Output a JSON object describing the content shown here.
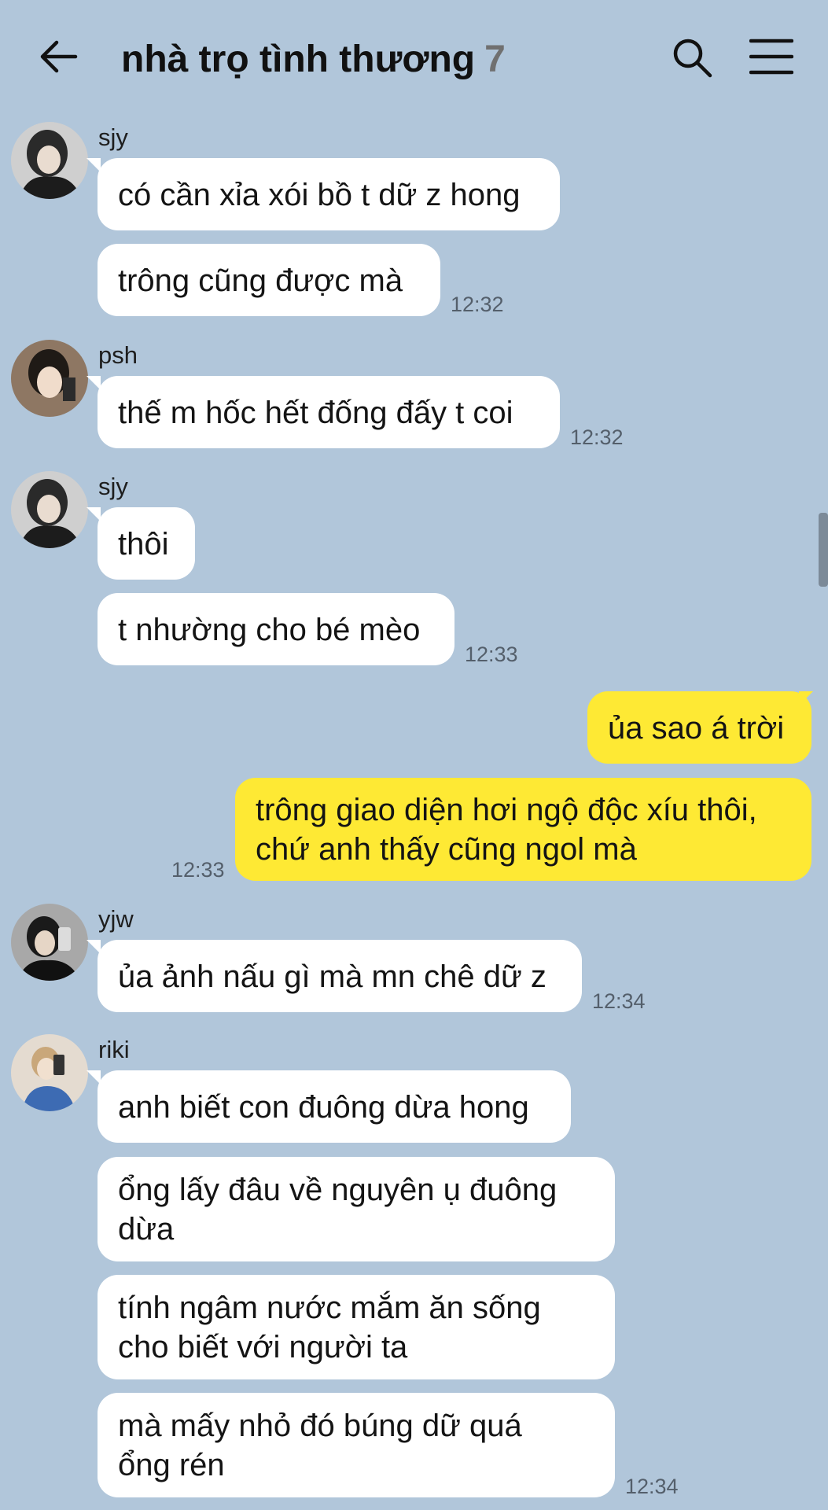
{
  "header": {
    "title": "nhà trọ tình thương",
    "member_count": "7"
  },
  "messages": {
    "m1": {
      "sender": "sjy",
      "text1": "có cần xỉa xói bồ t dữ z hong",
      "text2": "trông cũng được mà",
      "time": "12:32"
    },
    "m2": {
      "sender": "psh",
      "text1": "thế m hốc hết đống đấy t coi",
      "time": "12:32"
    },
    "m3": {
      "sender": "sjy",
      "text1": "thôi",
      "text2": "t nhường cho bé mèo",
      "time": "12:33"
    },
    "m4": {
      "text1": "ủa sao á trời",
      "text2_line1": "trông giao diện hơi ngộ độc xíu thôi,",
      "text2_line2": "chứ anh thấy cũng ngol mà",
      "time": "12:33"
    },
    "m5": {
      "sender": "yjw",
      "text1": "ủa ảnh nấu gì mà mn chê dữ z",
      "time": "12:34"
    },
    "m6": {
      "sender": "riki",
      "text1": "anh biết con đuông dừa hong",
      "text2_line1": "ổng lấy đâu về nguyên ụ đuông",
      "text2_line2": "dừa",
      "text3_line1": "tính ngâm nước mắm ăn sống",
      "text3_line2": "cho biết với người ta",
      "text4_line1": "mà mấy nhỏ đó búng dữ quá",
      "text4_line2": "ổng rén",
      "time": "12:34"
    }
  },
  "icons": {
    "back": "arrow-left-icon",
    "search": "search-icon",
    "menu": "hamburger-menu-icon"
  },
  "colors": {
    "background": "#b1c6da",
    "my_bubble": "#fee934",
    "other_bubble": "#ffffff"
  }
}
